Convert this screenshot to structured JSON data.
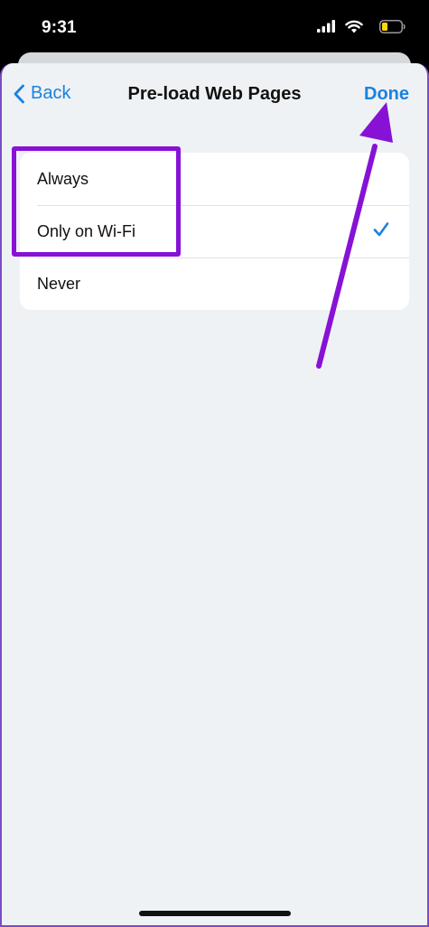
{
  "status_bar": {
    "time": "9:31"
  },
  "nav": {
    "back_label": "Back",
    "title": "Pre-load Web Pages",
    "done_label": "Done"
  },
  "options": [
    {
      "label": "Always",
      "selected": false
    },
    {
      "label": "Only on Wi-Fi",
      "selected": true
    },
    {
      "label": "Never",
      "selected": false
    }
  ],
  "colors": {
    "accent": "#1a82e0",
    "annotation": "#8712d6",
    "sheet_background": "#eff2f4"
  },
  "icons": [
    "cellular-signal-icon",
    "wifi-icon",
    "battery-icon",
    "chevron-left-icon",
    "checkmark-icon"
  ]
}
